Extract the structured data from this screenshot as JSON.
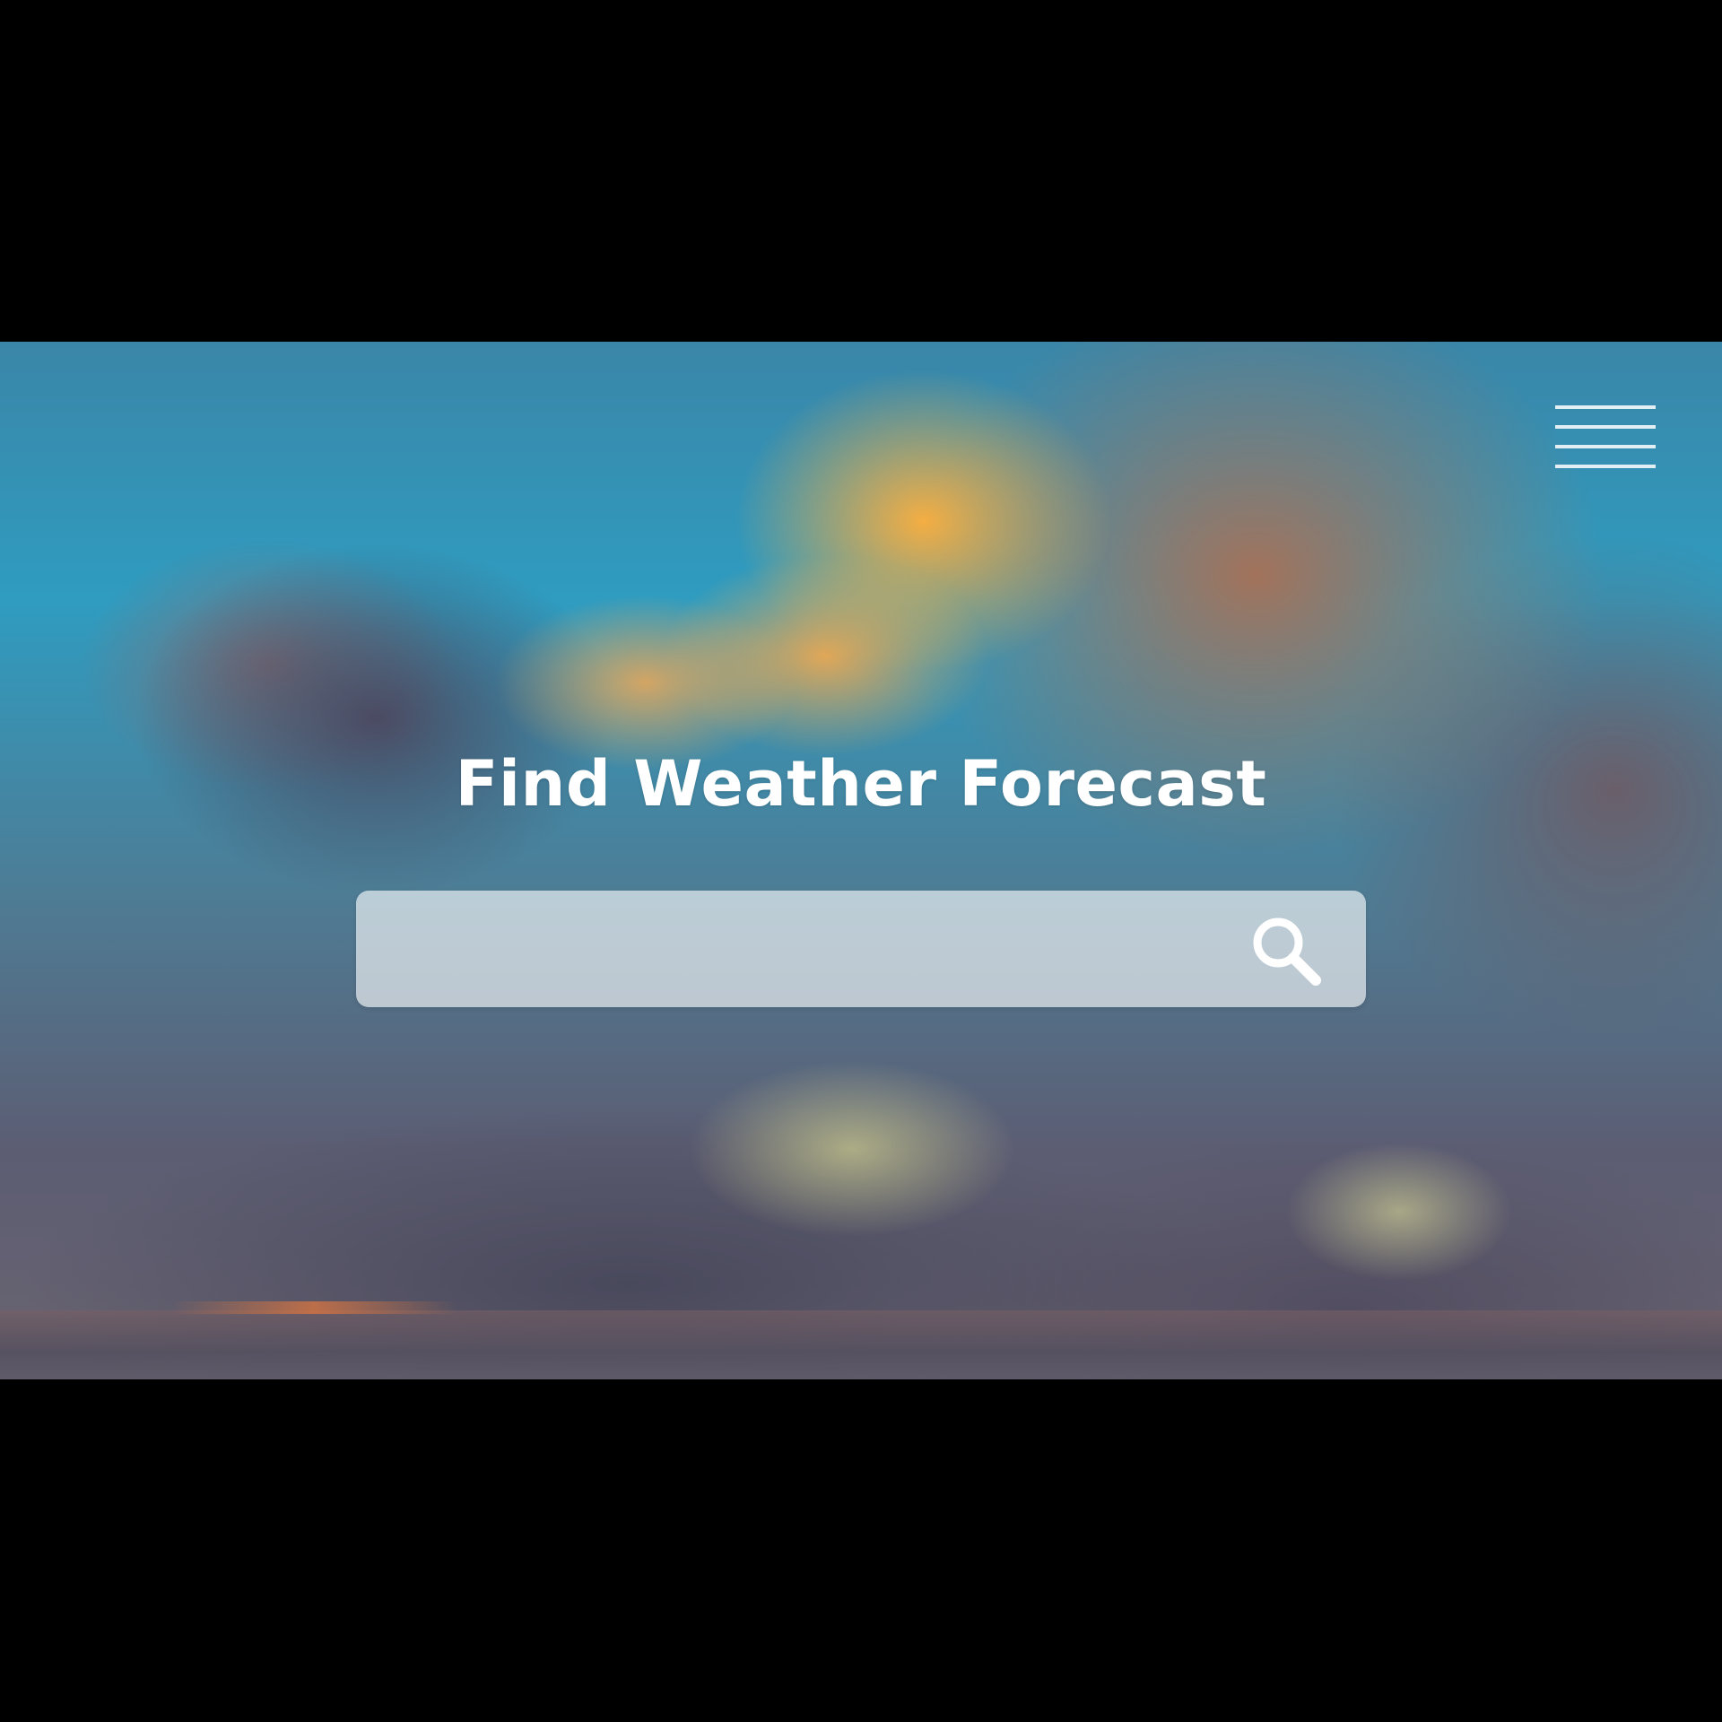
{
  "header": {
    "menu_icon": "hamburger-menu-icon"
  },
  "main": {
    "title": "Find Weather Forecast",
    "search": {
      "value": "",
      "placeholder": "",
      "icon": "search-icon"
    }
  },
  "colors": {
    "title_text": "#ffffff",
    "search_box_background": "rgba(255,255,255,0.62)",
    "letterbox": "#000000"
  }
}
